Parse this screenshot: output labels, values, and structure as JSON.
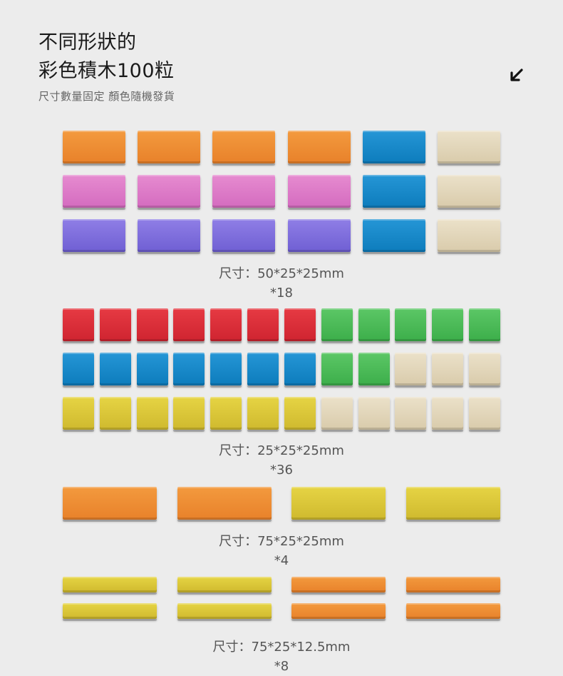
{
  "header": {
    "title_line1": "不同形狀的",
    "title_line2": "彩色積木100粒",
    "subtitle": "尺寸數量固定 顏色隨機發貨",
    "arrow_icon": "arrow-down-left-icon"
  },
  "colors": {
    "orange": "#ee8c33",
    "blue": "#1a89c8",
    "wood": "#e3d7bc",
    "pink": "#de7bc9",
    "purple": "#806fdc",
    "red": "#db2f3a",
    "green": "#4dbb57",
    "yellow": "#dcc73a"
  },
  "sections": [
    {
      "size_label": "尺寸：50*25*25mm",
      "count_label": "*18",
      "rows": [
        [
          "orange",
          "orange",
          "orange",
          "orange",
          "blue",
          "wood"
        ],
        [
          "pink",
          "pink",
          "pink",
          "pink",
          "blue",
          "wood"
        ],
        [
          "purple",
          "purple",
          "purple",
          "purple",
          "blue",
          "wood"
        ]
      ]
    },
    {
      "size_label": "尺寸：25*25*25mm",
      "count_label": "*36",
      "rows": [
        [
          "red",
          "red",
          "red",
          "red",
          "red",
          "red",
          "red",
          "green",
          "green",
          "green",
          "green",
          "green"
        ],
        [
          "blue",
          "blue",
          "blue",
          "blue",
          "blue",
          "blue",
          "blue",
          "green",
          "green",
          "wood",
          "wood",
          "wood"
        ],
        [
          "yellow",
          "yellow",
          "yellow",
          "yellow",
          "yellow",
          "yellow",
          "yellow",
          "wood",
          "wood",
          "wood",
          "wood",
          "wood"
        ]
      ]
    },
    {
      "size_label": "尺寸：75*25*25mm",
      "count_label": "*4",
      "rows": [
        [
          "orange",
          "orange",
          "yellow",
          "yellow"
        ]
      ]
    },
    {
      "size_label": "尺寸：75*25*12.5mm",
      "count_label": "*8",
      "rows": [
        [
          "yellow",
          "yellow",
          "orange",
          "orange"
        ],
        [
          "yellow",
          "yellow",
          "orange",
          "orange"
        ]
      ]
    }
  ]
}
